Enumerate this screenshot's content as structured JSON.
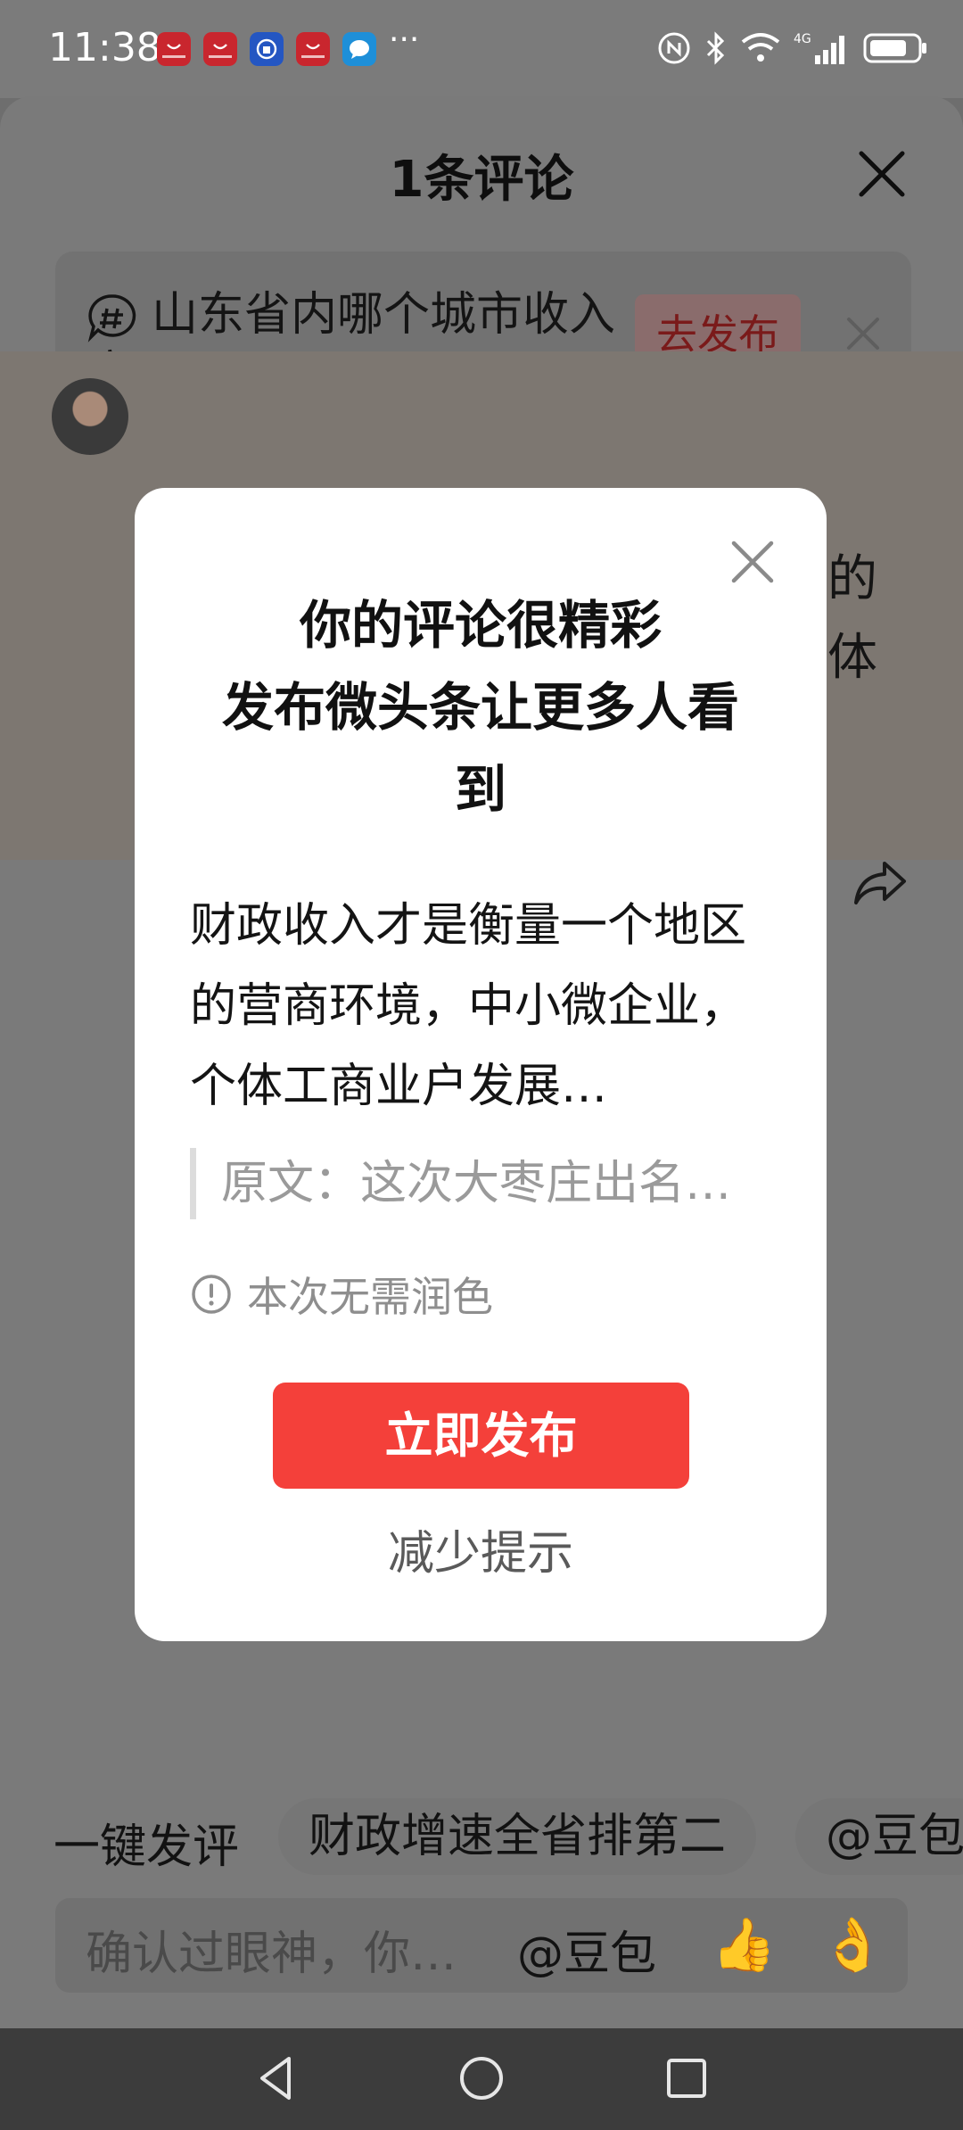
{
  "status_bar": {
    "time": "11:38",
    "app_icons": [
      "huawei-store-icon",
      "huawei-store-icon",
      "blue-app-icon",
      "huawei-store-icon",
      "message-app-icon"
    ],
    "more": "···",
    "network": "4G"
  },
  "sheet": {
    "title": "1条评论",
    "topic": {
      "text": "山东省内哪个城市收入高?",
      "action_label": "去发布"
    },
    "comment": {
      "visible_right_line1": "的",
      "visible_right_line2": "体"
    }
  },
  "bottom": {
    "quick_label": "一键发评",
    "chips": [
      "财政增速全省排第二",
      "@豆包"
    ],
    "input_placeholder": "确认过眼神，你…",
    "input_mention": "@豆包",
    "emoji_thumb": "👍",
    "emoji_ok": "👌"
  },
  "modal": {
    "title_line1": "你的评论很精彩",
    "title_line2": "发布微头条让更多人看",
    "title_line3": "到",
    "body": "财政收入才是衡量一个地区的营商环境，中小微企业，个体工商业户发展…",
    "original_label": "原文：这次大枣庄出名…",
    "notice": "本次无需润色",
    "publish_label": "立即发布",
    "reduce_label": "减少提示"
  },
  "colors": {
    "accent_red": "#f4403a",
    "overlay": "#7a7a7a"
  }
}
